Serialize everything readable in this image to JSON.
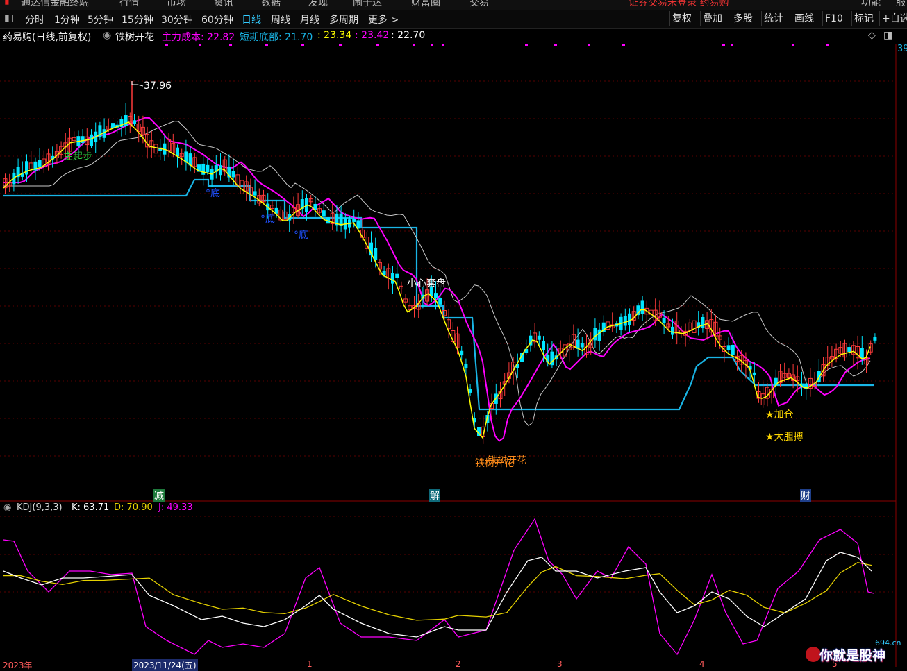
{
  "top_menu": {
    "app_title": "通达信金融终端",
    "items": [
      "行情",
      "市场",
      "资讯",
      "数据",
      "发现",
      "闹于达",
      "财富圈",
      "交易"
    ],
    "notice": "证券交易未登录  药易购",
    "right_items": [
      "功能",
      "服"
    ]
  },
  "period_bar": {
    "periods": [
      "分时",
      "1分钟",
      "5分钟",
      "15分钟",
      "30分钟",
      "60分钟",
      "日线",
      "周线",
      "月线",
      "多周期",
      "更多 >"
    ],
    "active": "日线",
    "tools": [
      "复权",
      "叠加",
      "多股",
      "统计",
      "画线",
      "F10",
      "标记",
      "+自选"
    ]
  },
  "stock": {
    "name": "药易购(日线,前复权)",
    "indicator": "铁树开花",
    "main_cost_label": "主力成本: 22.82",
    "short_bottom_label": "短期底部: 21.70",
    "v3": ": 23.34",
    "v4": ": 23.42",
    "v5": ": 22.70",
    "right_edge_price": "39"
  },
  "annotations": {
    "high_price": "37.96",
    "start": "主起步",
    "bottom": "底",
    "caution": "小心套盘",
    "tieshu_1": "铁树开花",
    "tieshu_2": "铁树开花",
    "jiacang": "★加仓",
    "dadan": "★大胆搏",
    "reduce": "减",
    "jie": "解",
    "cai": "财"
  },
  "kdj": {
    "title": "KDJ(9,3,3)",
    "k": "K: 63.71",
    "d": "D: 70.90",
    "j": "J: 49.33"
  },
  "time_axis": {
    "labels": [
      "2023年",
      "2023/11/24(五)",
      "1",
      "2",
      "3",
      "4",
      "5"
    ]
  },
  "watermark": {
    "site": "694.cn",
    "text": "你就是股神"
  },
  "colors": {
    "up": "#ff3b3b",
    "down": "#00e5ff",
    "ma_yellow": "#ffff00",
    "ma_magenta": "#ff00ff",
    "ma_white": "#c8c8c8",
    "support": "#19b5e6",
    "k": "#ffffff",
    "d": "#e6d200",
    "j": "#ff00ff"
  }
}
